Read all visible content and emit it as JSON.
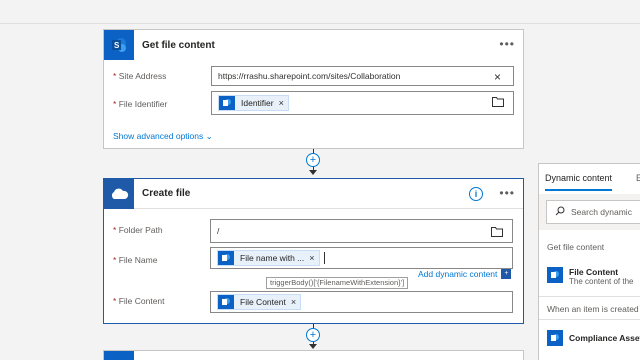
{
  "colors": {
    "sharepoint": "#0b62c4",
    "onedrive": "#1f5aa8",
    "link": "#0078d4"
  },
  "get_file_content": {
    "title": "Get file content",
    "icon": "sharepoint-icon",
    "fields": {
      "site_address_label": "Site Address",
      "site_address_value": "https://rrashu.sharepoint.com/sites/Collaboration",
      "file_identifier_label": "File Identifier",
      "file_identifier_token": "Identifier"
    },
    "advanced_label": "Show advanced options",
    "required_marker": "*"
  },
  "create_file": {
    "title": "Create file",
    "icon": "onedrive-icon",
    "fields": {
      "folder_path_label": "Folder Path",
      "folder_path_value": "/",
      "file_name_label": "File Name",
      "file_name_token": "File name with ...",
      "file_content_label": "File Content",
      "file_content_token": "File Content"
    },
    "add_dynamic_content": "Add dynamic content",
    "tooltip": "triggerBody()['{FilenameWithExtension}']",
    "required_marker": "*"
  },
  "dynamic_panel": {
    "tab_active": "Dynamic content",
    "tab_other": "E",
    "search_placeholder": "Search dynamic",
    "sections": [
      {
        "title": "Get file content",
        "items": [
          {
            "title": "File Content",
            "description": "The content of the"
          }
        ]
      },
      {
        "title": "When an item is created",
        "items": [
          {
            "title": "Compliance Asset"
          }
        ]
      }
    ]
  },
  "connectors": {
    "plus_label": "+",
    "token_remove": "×",
    "clear": "×",
    "more": "•••",
    "info": "i"
  }
}
